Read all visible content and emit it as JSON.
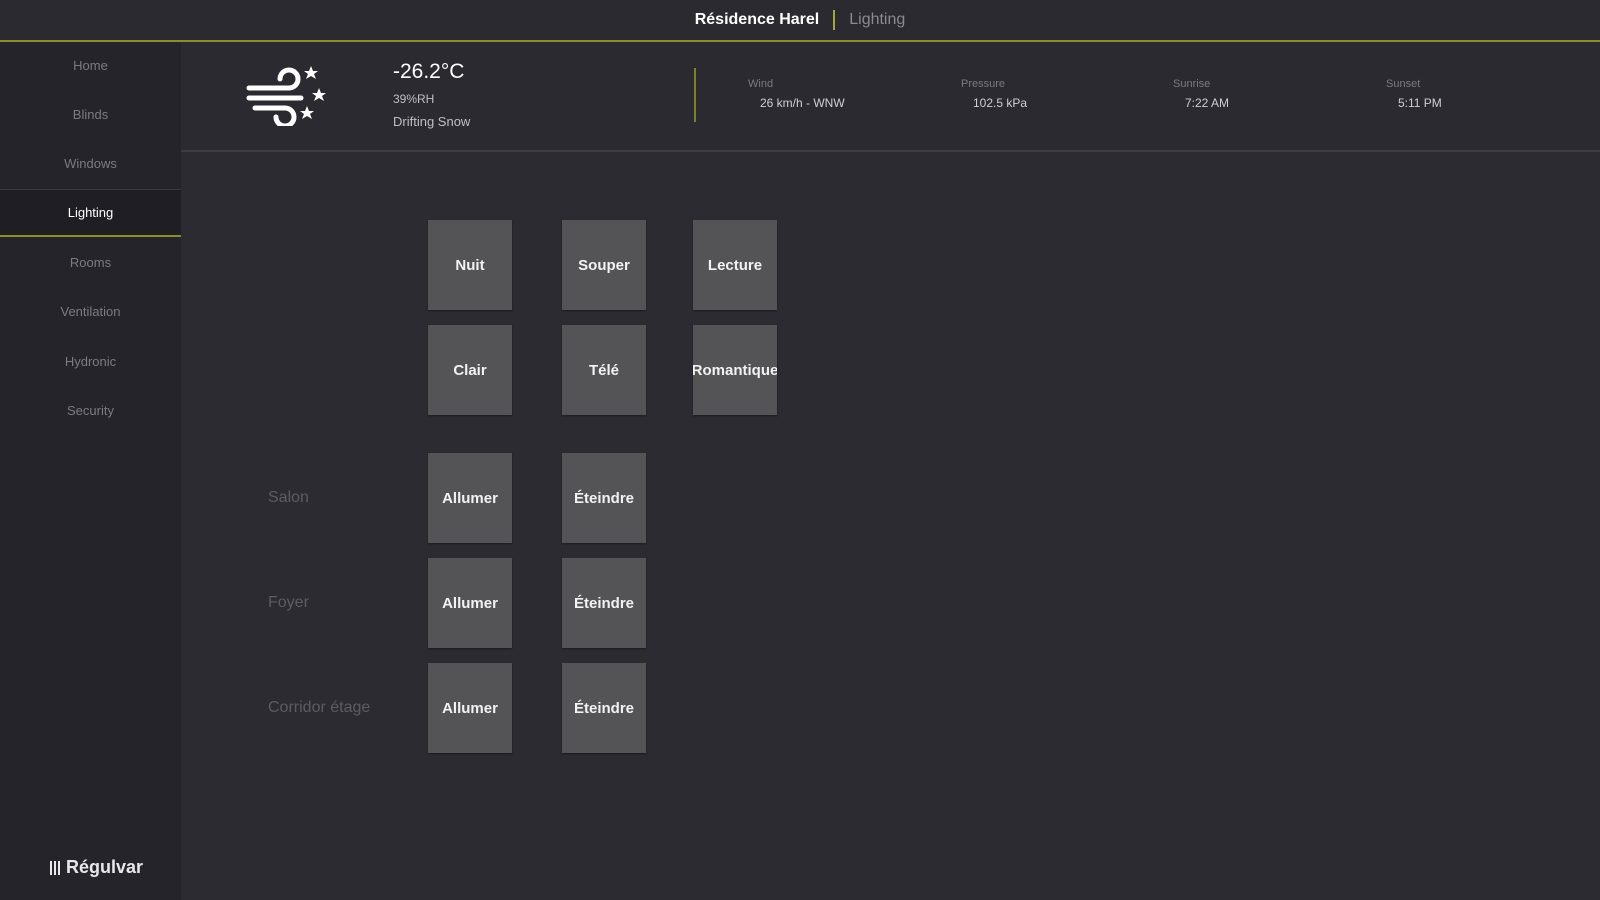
{
  "header": {
    "title": "Résidence Harel",
    "section": "Lighting",
    "accent": "#8a8f2e"
  },
  "sidebar": {
    "items": [
      {
        "label": "Home",
        "active": false
      },
      {
        "label": "Blinds",
        "active": false
      },
      {
        "label": "Windows",
        "active": false
      },
      {
        "label": "Lighting",
        "active": true
      },
      {
        "label": "Rooms",
        "active": false
      },
      {
        "label": "Ventilation",
        "active": false
      },
      {
        "label": "Hydronic",
        "active": false
      },
      {
        "label": "Security",
        "active": false
      }
    ],
    "brand": "Régulvar"
  },
  "weather": {
    "icon": "wind-snow-icon",
    "temperature": "-26.2°C",
    "humidity": "39%RH",
    "condition": "Drifting Snow",
    "stats": [
      {
        "label": "Wind",
        "value": "26 km/h - WNW"
      },
      {
        "label": "Pressure",
        "value": "102.5 kPa"
      },
      {
        "label": "Sunrise",
        "value": "7:22 AM"
      },
      {
        "label": "Sunset",
        "value": "5:11 PM"
      }
    ]
  },
  "scenes": [
    [
      "Nuit",
      "Souper",
      "Lecture"
    ],
    [
      "Clair",
      "Télé",
      "Romantique"
    ]
  ],
  "rooms": [
    {
      "name": "Salon",
      "on": "Allumer",
      "off": "Éteindre"
    },
    {
      "name": "Foyer",
      "on": "Allumer",
      "off": "Éteindre"
    },
    {
      "name": "Corridor étage",
      "on": "Allumer",
      "off": "Éteindre"
    }
  ]
}
